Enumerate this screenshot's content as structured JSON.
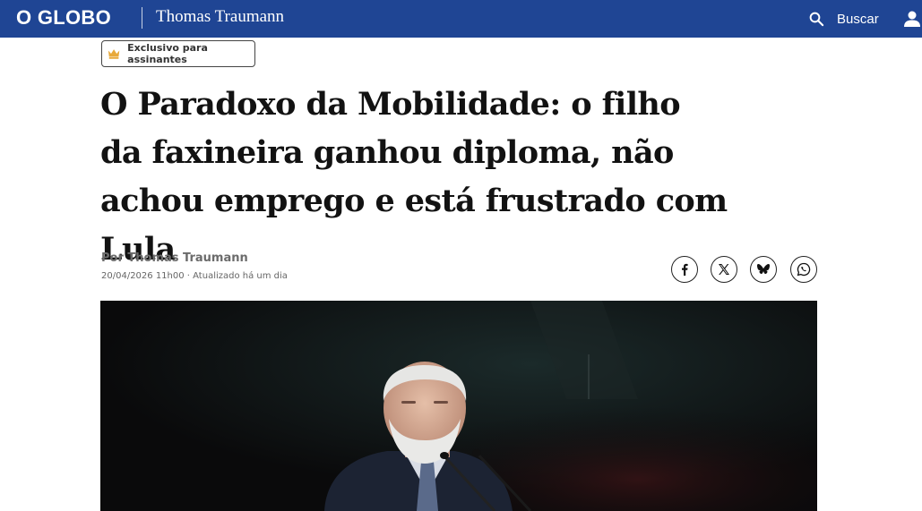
{
  "header": {
    "logo": "O GLOBO",
    "section": "Thomas Traumann",
    "search_label": "Buscar",
    "bg_color": "#1f4594"
  },
  "badge": {
    "label": "Exclusivo para assinantes",
    "icon": "crown-icon",
    "icon_color": "#e8a93a"
  },
  "article": {
    "headline": "O Paradoxo da Mobilidade: o filho da faxineira ganhou diploma, não achou emprego e está frustrado com Lula",
    "byline": "Por Thomas Traumann",
    "dateline": "20/04/2026 11h00 · Atualizado há um dia"
  },
  "share": [
    {
      "icon": "facebook-icon"
    },
    {
      "icon": "x-icon"
    },
    {
      "icon": "bluesky-icon"
    },
    {
      "icon": "whatsapp-icon"
    }
  ]
}
